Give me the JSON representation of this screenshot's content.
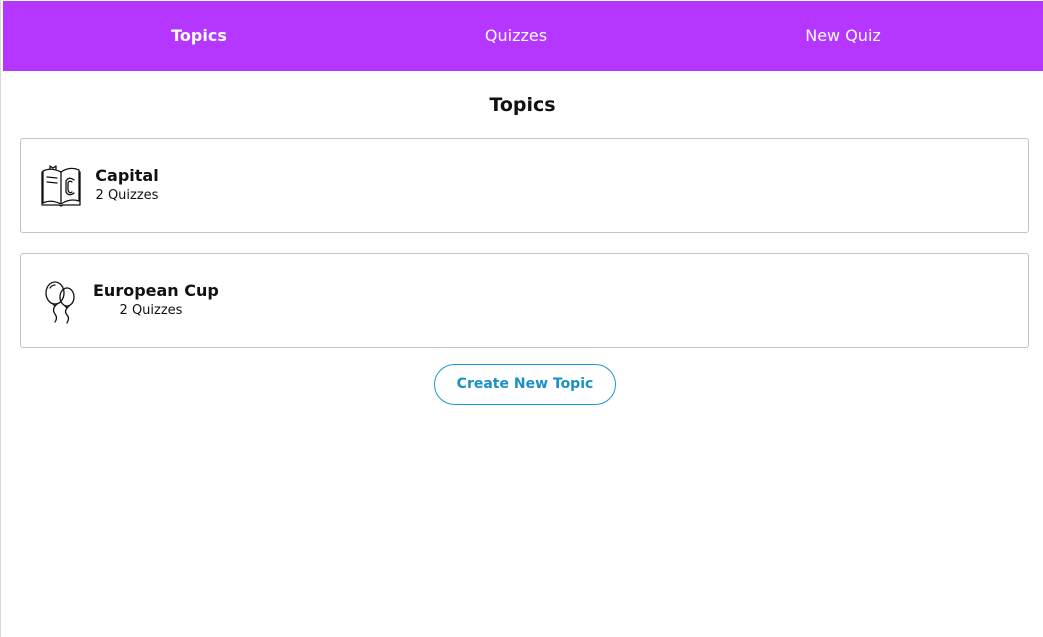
{
  "nav": {
    "items": [
      {
        "label": "Topics",
        "active": true
      },
      {
        "label": "Quizzes",
        "active": false
      },
      {
        "label": "New Quiz",
        "active": false
      }
    ]
  },
  "page": {
    "title": "Topics"
  },
  "topics": [
    {
      "name": "Capital",
      "count": "2 Quizzes",
      "icon": "book-icon"
    },
    {
      "name": "European Cup",
      "count": "2 Quizzes",
      "icon": "balloons-icon"
    }
  ],
  "actions": {
    "create_label": "Create New Topic"
  },
  "colors": {
    "nav_bg": "#b536ff",
    "button_accent": "#1a9bd7",
    "card_border": "#c4c4c4"
  }
}
